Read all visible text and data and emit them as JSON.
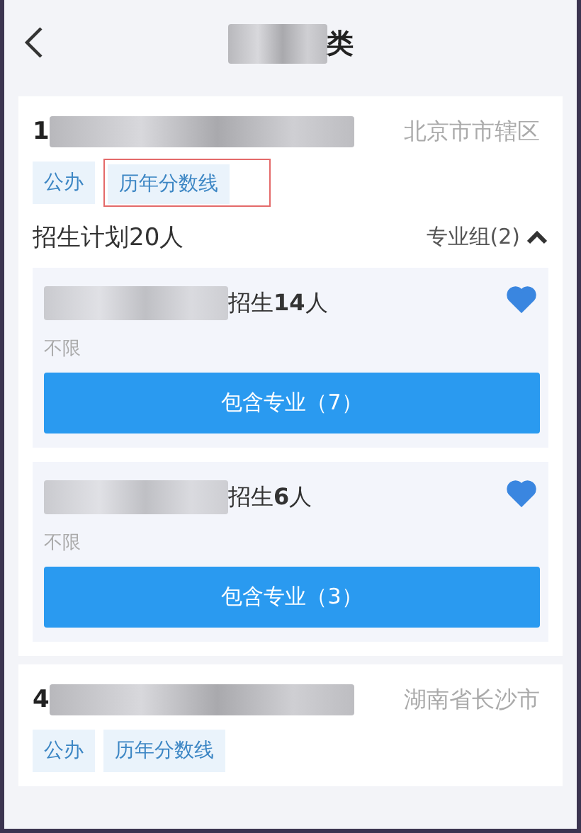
{
  "header": {
    "title_suffix": "类"
  },
  "schools": [
    {
      "name_prefix": "1",
      "location": "北京市市辖区",
      "tags": [
        {
          "label": "公办",
          "highlighted": false
        },
        {
          "label": "历年分数线",
          "highlighted": true
        }
      ],
      "plan": "招生计划20人",
      "group_toggle": "专业组(2)",
      "expanded": true,
      "groups": [
        {
          "enroll_prefix": "招生",
          "enroll_count": "14",
          "enroll_suffix": "人",
          "favorited": true,
          "limit": "不限",
          "button": "包含专业（7）"
        },
        {
          "enroll_prefix": "招生",
          "enroll_count": "6",
          "enroll_suffix": "人",
          "favorited": true,
          "limit": "不限",
          "button": "包含专业（3）"
        }
      ]
    },
    {
      "name_prefix": "4",
      "location": "湖南省长沙市",
      "tags": [
        {
          "label": "公办",
          "highlighted": false
        },
        {
          "label": "历年分数线",
          "highlighted": false
        }
      ]
    }
  ]
}
